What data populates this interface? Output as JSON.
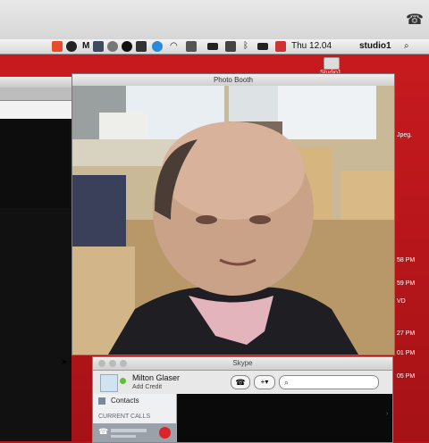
{
  "menubar": {
    "clock": "Thu 12.04",
    "user": "studio1"
  },
  "desktop": {
    "folder_label": "Studio1",
    "right_labels": [
      "Jpeg.",
      "58 PM",
      "59 PM",
      "VD",
      "27 PM",
      "01 PM",
      "05 PM"
    ]
  },
  "photobooth": {
    "title": "Photo Booth"
  },
  "skype": {
    "title": "Skype",
    "contact_name": "Milton Glaser",
    "contact_status": "Add Credit",
    "nav_contacts": "Contacts",
    "section_current_calls": "CURRENT CALLS"
  },
  "colors": {
    "desktop_red": "#b3161b",
    "skype_hangup": "#d9252a"
  }
}
